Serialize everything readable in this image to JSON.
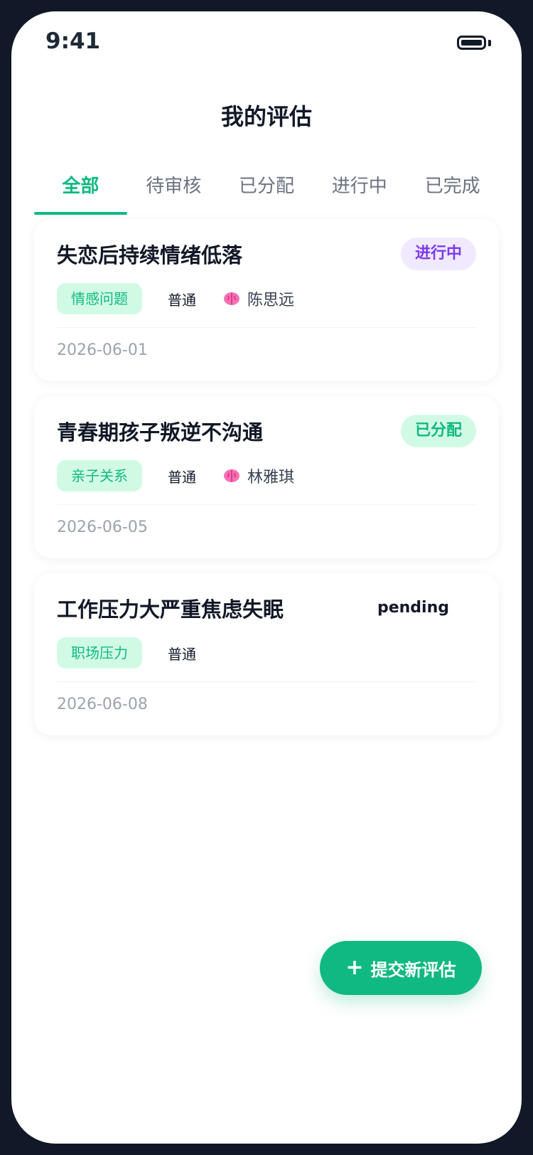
{
  "status_bar": {
    "time": "9:41"
  },
  "header": {
    "title": "我的评估"
  },
  "tabs": [
    {
      "label": "全部",
      "active": true
    },
    {
      "label": "待审核",
      "active": false
    },
    {
      "label": "已分配",
      "active": false
    },
    {
      "label": "进行中",
      "active": false
    },
    {
      "label": "已完成",
      "active": false
    }
  ],
  "assessments": [
    {
      "title": "失恋后持续情绪低落",
      "status": "进行中",
      "category": "情感问题",
      "priority": "普通",
      "counselor": "陈思远",
      "counselor_icon": "brain-icon",
      "date": "2026-06-01"
    },
    {
      "title": "青春期孩子叛逆不沟通",
      "status": "已分配",
      "category": "亲子关系",
      "priority": "普通",
      "counselor": "林雅琪",
      "counselor_icon": "brain-icon",
      "date": "2026-06-05"
    },
    {
      "title": "工作压力大严重焦虑失眠",
      "status": "pending",
      "category": "职场压力",
      "priority": "普通",
      "counselor": "",
      "date": "2026-06-08"
    }
  ],
  "fab": {
    "label": "提交新评估",
    "icon": "plus-icon"
  },
  "colors": {
    "accent": "#10b981",
    "accent_light": "#d1fae5",
    "in_progress": "#7c3aed",
    "in_progress_bg": "#f0e9ff"
  }
}
